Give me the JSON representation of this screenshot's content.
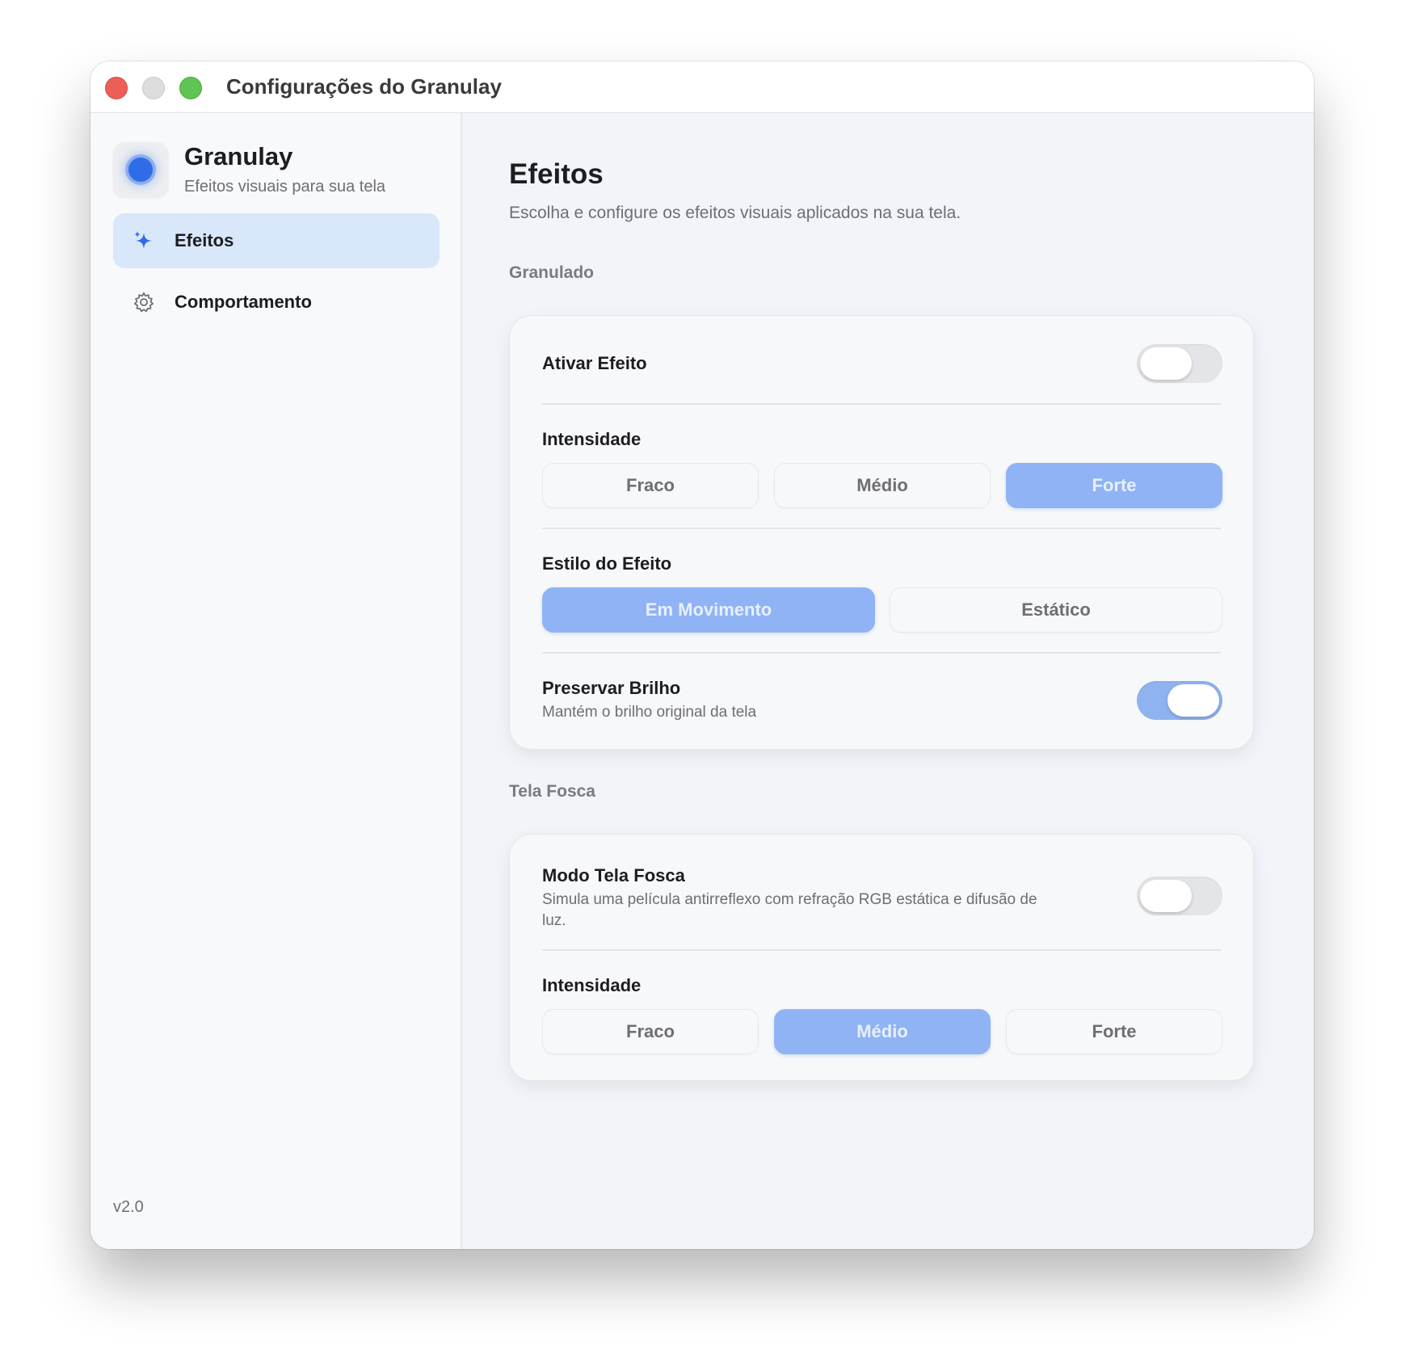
{
  "window": {
    "title": "Configurações do Granulay"
  },
  "sidebar": {
    "app_name": "Granulay",
    "app_subtitle": "Efeitos visuais para sua tela",
    "items": [
      {
        "label": "Efeitos",
        "icon": "sparkles-icon",
        "active": true
      },
      {
        "label": "Comportamento",
        "icon": "gear-icon",
        "active": false
      }
    ],
    "version": "v2.0"
  },
  "main": {
    "title": "Efeitos",
    "subtitle": "Escolha e configure os efeitos visuais aplicados na sua tela.",
    "granulado": {
      "section_label": "Granulado",
      "activate": {
        "label": "Ativar Efeito",
        "on": false
      },
      "intensity": {
        "label": "Intensidade",
        "options": [
          "Fraco",
          "Médio",
          "Forte"
        ],
        "selected": "Forte"
      },
      "style": {
        "label": "Estilo do Efeito",
        "options": [
          "Em Movimento",
          "Estático"
        ],
        "selected": "Em Movimento"
      },
      "preserve": {
        "label": "Preservar Brilho",
        "description": "Mantém o brilho original da tela",
        "on": true
      }
    },
    "tela_fosca": {
      "section_label": "Tela Fosca",
      "mode": {
        "label": "Modo Tela Fosca",
        "description": "Simula uma película antirreflexo com refração RGB estática e difusão de luz.",
        "on": false
      },
      "intensity": {
        "label": "Intensidade",
        "options": [
          "Fraco",
          "Médio",
          "Forte"
        ],
        "selected": "Médio"
      }
    }
  },
  "colors": {
    "accent": "#8fb3f5",
    "sidebar_active": "#d9e7fb",
    "traffic_red": "#ec5f57",
    "traffic_green": "#5fc453"
  }
}
